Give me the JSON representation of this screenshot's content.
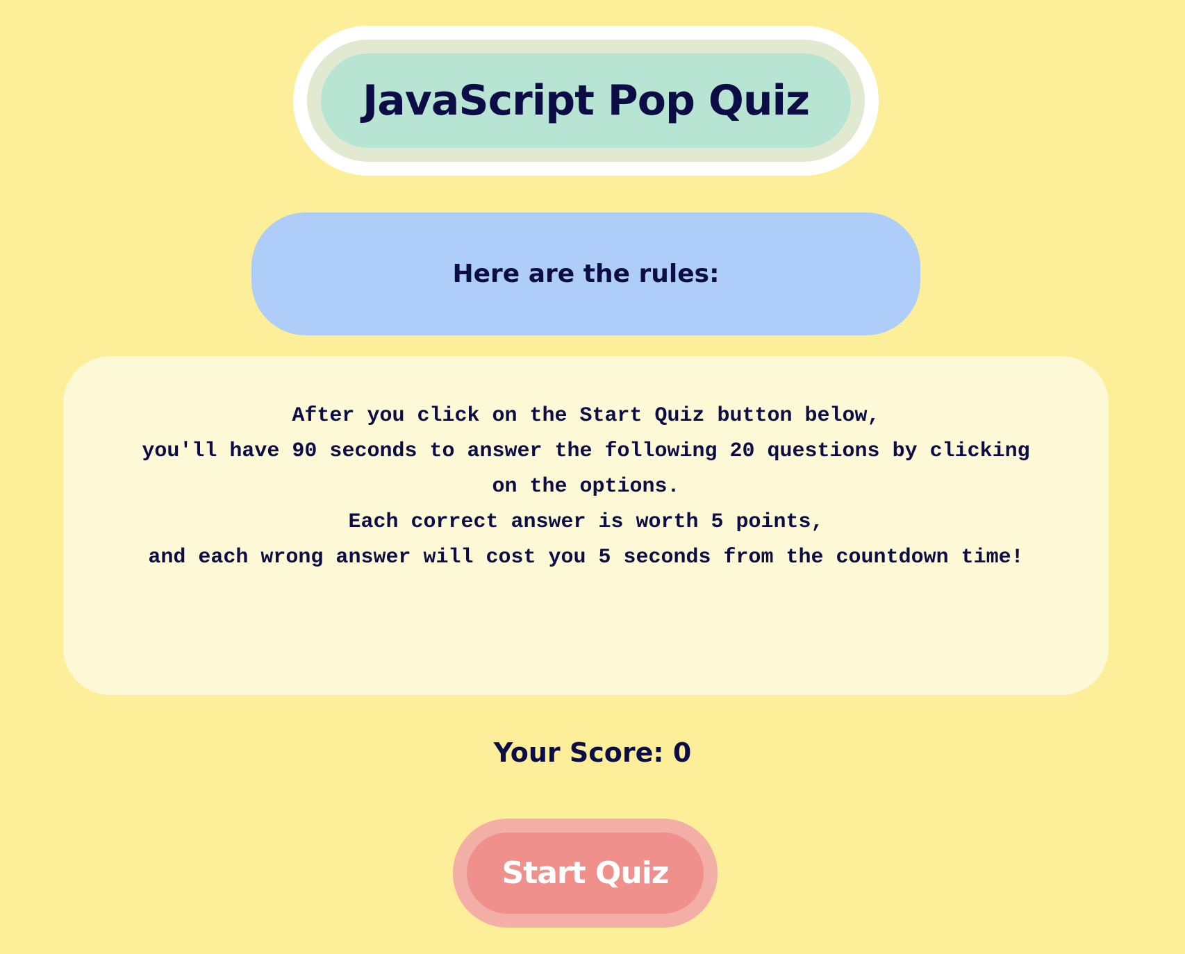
{
  "header": {
    "title": "JavaScript Pop Quiz"
  },
  "rules": {
    "heading": "Here are the rules:",
    "lines": [
      "After you click on the Start Quiz button below,",
      "you'll have 90 seconds to answer the following 20 questions by clicking",
      "on the options.",
      "Each correct answer is worth 5 points,",
      "and each wrong answer will cost you 5 seconds from the countdown time!"
    ]
  },
  "score": {
    "text": "Your Score: 0"
  },
  "actions": {
    "start_label": "Start Quiz"
  },
  "colors": {
    "background": "#fdef99",
    "text": "#0c0d45",
    "title_core": "#b8e5d3",
    "rules_pill": "#aecdf8",
    "rules_card": "#fdf8d6",
    "start_button": "#f0908d"
  }
}
